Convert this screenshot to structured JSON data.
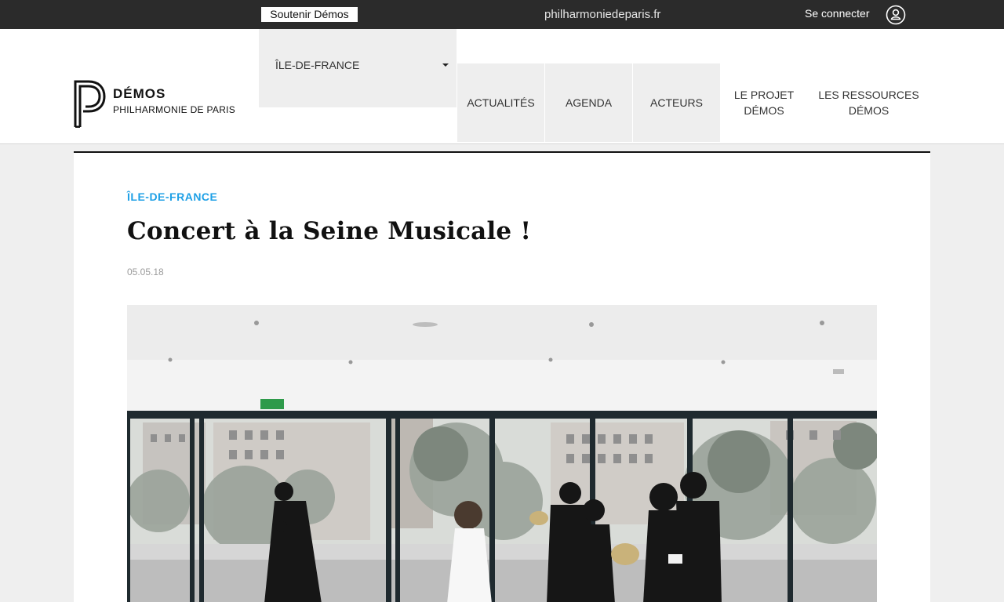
{
  "topbar": {
    "support_label": "Soutenir Démos",
    "site_link": "philharmoniedeparis.fr",
    "login_label": "Se connecter"
  },
  "brand": {
    "name": "DÉMOS",
    "subtitle": "PHILHARMONIE DE PARIS"
  },
  "region_select": {
    "selected": "ÎLE-DE-FRANCE"
  },
  "nav": {
    "items": [
      {
        "label": "ACTUALITÉS"
      },
      {
        "label": "AGENDA"
      },
      {
        "label": "ACTEURS"
      },
      {
        "label": "LE PROJET DÉMOS"
      },
      {
        "label": "LES RESSOURCES DÉMOS"
      }
    ]
  },
  "article": {
    "category": "ÎLE-DE-FRANCE",
    "title": "Concert à la Seine Musicale !",
    "date": "05.05.18"
  },
  "colors": {
    "topbar_bg": "#2b2b2b",
    "accent": "#1ea0e6",
    "nav_bg": "#eeeeee",
    "page_bg": "#efefef"
  },
  "icons": {
    "user": "user-circle-icon",
    "caret": "chevron-down-icon"
  }
}
